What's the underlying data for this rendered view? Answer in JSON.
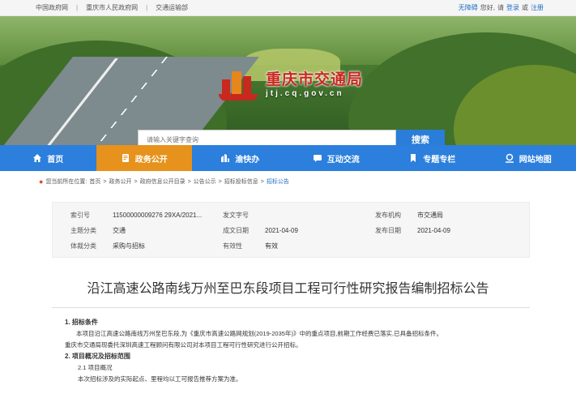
{
  "topbar": {
    "links": [
      "中国政府网",
      "重庆市人民政府网",
      "交通运输部"
    ],
    "separator": "|",
    "user": "无障碍",
    "greeting": "您好,",
    "please": "请",
    "login": "登录",
    "or": "或",
    "register": "注册"
  },
  "logo": {
    "name": "重庆市交通局",
    "domain": "jtj.cq.gov.cn"
  },
  "search": {
    "placeholder": "请输入关键字查询",
    "button": "搜索"
  },
  "nav": [
    {
      "label": "首页",
      "icon": "home-icon",
      "active": false
    },
    {
      "label": "政务公开",
      "icon": "document-icon",
      "active": true
    },
    {
      "label": "渝快办",
      "icon": "building-icon",
      "active": false
    },
    {
      "label": "互动交流",
      "icon": "chat-icon",
      "active": false
    },
    {
      "label": "专题专栏",
      "icon": "bookmark-icon",
      "active": false
    },
    {
      "label": "网站地图",
      "icon": "map-pin-icon",
      "active": false
    }
  ],
  "breadcrumb": {
    "prefix": "您当前所在位置:",
    "items": [
      "首页",
      "政务公开",
      "政府信息公开目录",
      "公告公示",
      "招标投标信息"
    ],
    "current": "招标公告",
    "sep": ">"
  },
  "meta": {
    "index_label": "索引号",
    "index_value": "11500000009276 29XA/2021...",
    "doc_label": "发文字号",
    "doc_value": "",
    "org_label": "发布机构",
    "org_value": "市交通局",
    "topic_label": "主题分类",
    "topic_value": "交通",
    "created_label": "成文日期",
    "created_value": "2021-04-09",
    "published_label": "发布日期",
    "published_value": "2021-04-09",
    "genre_label": "体裁分类",
    "genre_value": "采购与招标",
    "validity_label": "有效性",
    "validity_value": "有效"
  },
  "article": {
    "title": "沿江高速公路南线万州至巴东段项目工程可行性研究报告编制招标公告",
    "s1_heading": "1. 招标条件",
    "s1_p1": "本项目沿江高速公路南线万州至巴东段,为《重庆市高速公路网规划(2019-2035年)》中的重点项目,前期工作经费已落实,已具备招标条件。",
    "s1_p2": "重庆市交通局现委托深圳高速工程顾问有限公司对本项目工程可行性研究进行公开招标。",
    "s2_heading": "2. 项目概况及招标范围",
    "s2_1": "2.1 项目概况",
    "s2_p": "本次招标涉及的实际起点、里程均以工可报告推荐方案为准。"
  },
  "colors": {
    "nav_bg": "#2c7fdc",
    "nav_active": "#e6921c",
    "logo_red": "#c8281e",
    "link_blue": "#1f6fc5"
  }
}
